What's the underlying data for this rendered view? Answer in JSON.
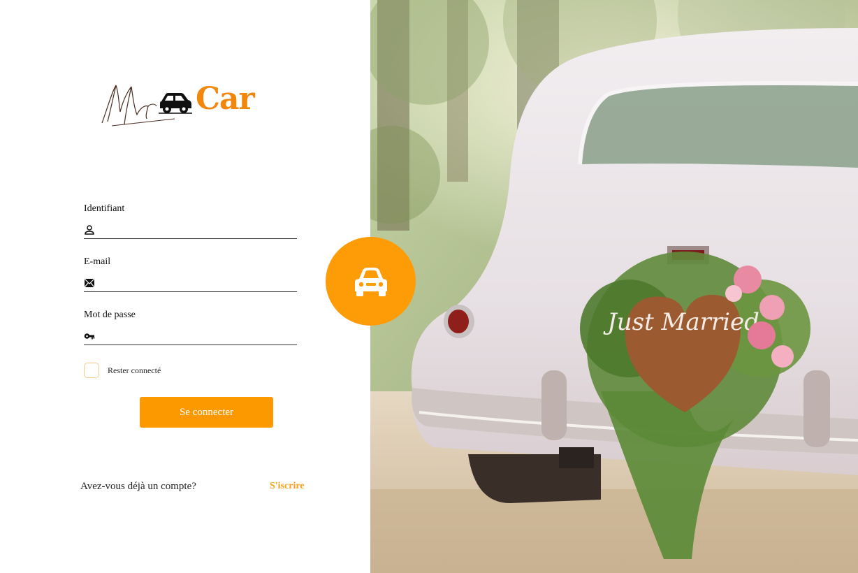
{
  "brand": {
    "logo_name": "Mr Car",
    "logo_text": "Car",
    "accent_color": "#fd9900",
    "logo_icon": "car-icon"
  },
  "form": {
    "identifier_label": "Identifiant",
    "identifier_value": "",
    "identifier_icon": "user-icon",
    "email_label": "E-mail",
    "email_value": "",
    "email_icon": "envelope-icon",
    "password_label": "Mot de passe",
    "password_value": "",
    "password_icon": "key-icon",
    "remember_label": "Rester connecté",
    "remember_checked": false,
    "submit_label": "Se connecter"
  },
  "footer": {
    "question": "Avez-vous déjà un compte?",
    "register_link": "S'iscrire"
  },
  "badge": {
    "icon": "car-front-icon"
  },
  "photo": {
    "sign_text": "Just Married"
  }
}
